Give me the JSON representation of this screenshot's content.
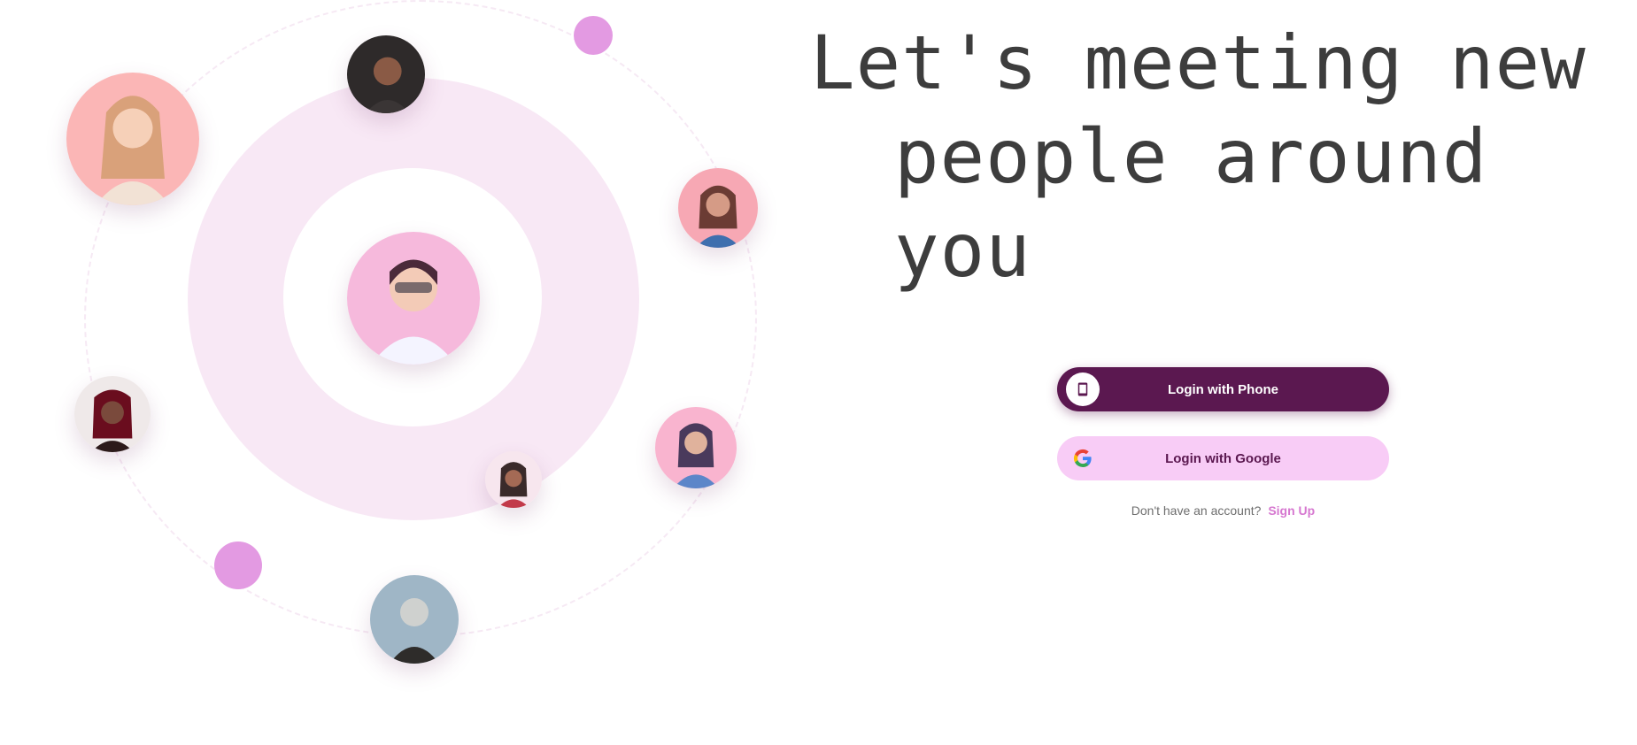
{
  "headline": {
    "line1": "Let's meeting new",
    "line2": "people around you"
  },
  "auth": {
    "apple_label": "Login with Phone",
    "google_label": "Login with Google",
    "signup_prompt": "Don't have an account?",
    "signup_link": "Sign Up"
  },
  "colors": {
    "primary": "#5b1850",
    "secondary": "#f8ccf6",
    "accent": "#e39ae2",
    "ring": "#f8e8f5",
    "headline": "#3d3d3d"
  },
  "icons": {
    "apple_button_icon": "phone-icon",
    "google_button_icon": "google-icon"
  }
}
